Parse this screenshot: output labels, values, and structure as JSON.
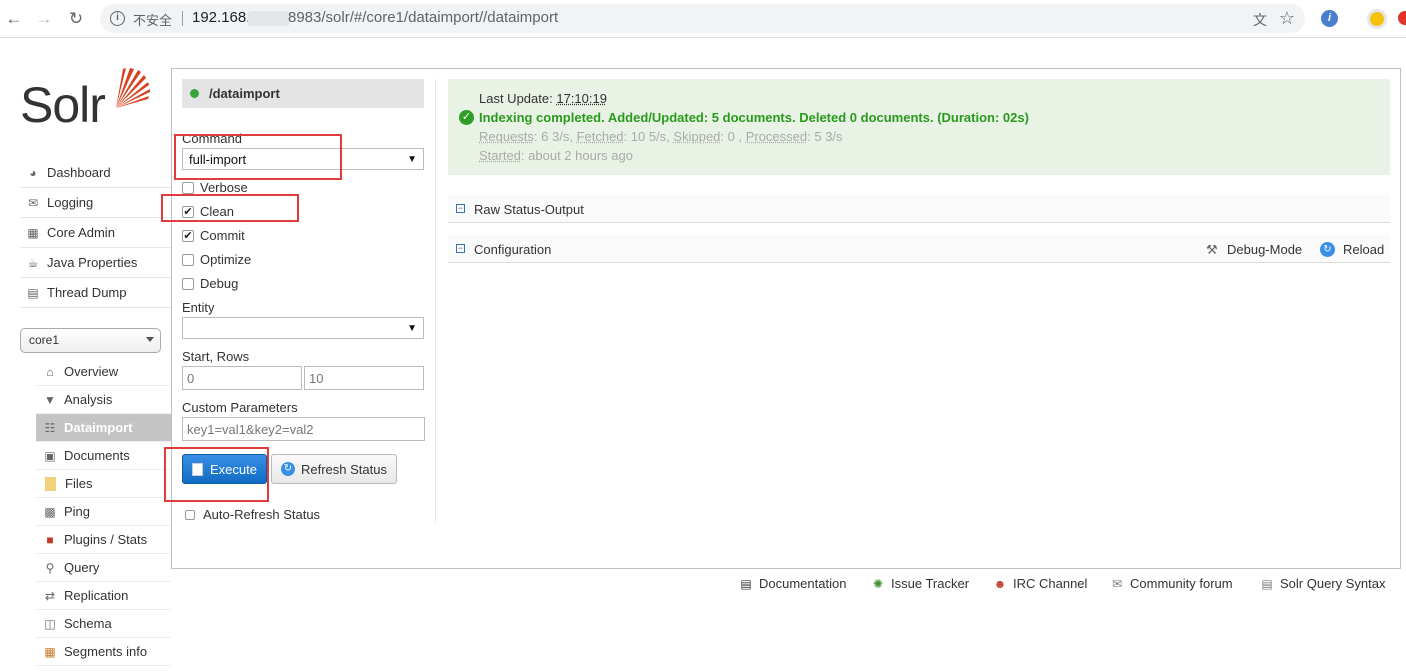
{
  "browser": {
    "security_label": "不安全",
    "url_host": "192.168.",
    "url_path": "8983/solr/#/core1/dataimport//dataimport"
  },
  "logo": {
    "text": "Solr"
  },
  "menu": [
    {
      "label": "Dashboard",
      "icon": "dashboard-icon"
    },
    {
      "label": "Logging",
      "icon": "logging-icon"
    },
    {
      "label": "Core Admin",
      "icon": "core-admin-icon"
    },
    {
      "label": "Java Properties",
      "icon": "java-properties-icon"
    },
    {
      "label": "Thread Dump",
      "icon": "thread-dump-icon"
    }
  ],
  "core_selector": {
    "value": "core1"
  },
  "core_menu": [
    {
      "label": "Overview",
      "icon": "overview-icon"
    },
    {
      "label": "Analysis",
      "icon": "analysis-icon"
    },
    {
      "label": "Dataimport",
      "icon": "dataimport-icon"
    },
    {
      "label": "Documents",
      "icon": "documents-icon"
    },
    {
      "label": "Files",
      "icon": "files-icon"
    },
    {
      "label": "Ping",
      "icon": "ping-icon"
    },
    {
      "label": "Plugins / Stats",
      "icon": "plugins-icon"
    },
    {
      "label": "Query",
      "icon": "query-icon"
    },
    {
      "label": "Replication",
      "icon": "replication-icon"
    },
    {
      "label": "Schema",
      "icon": "schema-icon"
    },
    {
      "label": "Segments info",
      "icon": "segments-icon"
    }
  ],
  "handler": {
    "name": "/dataimport"
  },
  "form": {
    "command_label": "Command",
    "command_value": "full-import",
    "options": [
      {
        "label": "Verbose",
        "checked": false
      },
      {
        "label": "Clean",
        "checked": true
      },
      {
        "label": "Commit",
        "checked": true
      },
      {
        "label": "Optimize",
        "checked": false
      },
      {
        "label": "Debug",
        "checked": false
      }
    ],
    "entity_label": "Entity",
    "entity_value": "",
    "start_rows_label": "Start, Rows",
    "start_value": "0",
    "rows_value": "10",
    "custom_params_label": "Custom Parameters",
    "custom_params_value": "key1=val1&key2=val2",
    "execute_label": "Execute",
    "refresh_label": "Refresh Status",
    "auto_refresh_label": "Auto-Refresh Status"
  },
  "status": {
    "last_update_label": "Last Update:",
    "last_update_time": "17:10:19",
    "message": "Indexing completed. Added/Updated: 5 documents. Deleted 0 documents. (Duration: 02s)",
    "requests_label": "Requests",
    "requests_value": ": 6 3/s, ",
    "fetched_label": "Fetched",
    "fetched_value": ": 10 5/s, ",
    "skipped_label": "Skipped",
    "skipped_value": ": 0 , ",
    "processed_label": "Processed",
    "processed_value": ": 5 3/s",
    "started_label": "Started",
    "started_value": ": about 2 hours ago"
  },
  "sections": {
    "raw_status": "Raw Status-Output",
    "configuration": "Configuration",
    "debug_mode": "Debug-Mode",
    "reload": "Reload"
  },
  "footer": [
    {
      "label": "Documentation",
      "icon": "documentation-icon"
    },
    {
      "label": "Issue Tracker",
      "icon": "bug-icon"
    },
    {
      "label": "IRC Channel",
      "icon": "irc-icon"
    },
    {
      "label": "Community forum",
      "icon": "mail-icon"
    },
    {
      "label": "Solr Query Syntax",
      "icon": "query-syntax-icon"
    }
  ],
  "colors": {
    "accent_blue": "#0f6cc4",
    "success_green": "#2a9a1c",
    "annotation_red": "#e23b3b"
  }
}
